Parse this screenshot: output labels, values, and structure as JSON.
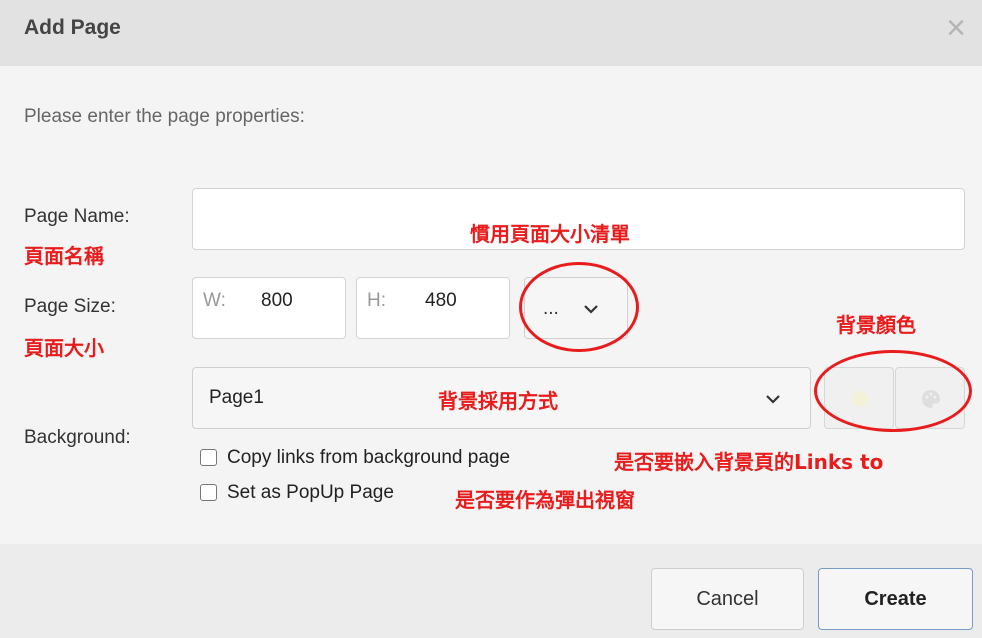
{
  "dialog": {
    "title": "Add Page",
    "close_glyph": "×",
    "intro": "Please enter the page properties:"
  },
  "page_name": {
    "label": "Page Name:",
    "value": "",
    "annotation": "頁面名稱",
    "hint": "慣用頁面大小清單"
  },
  "page_size": {
    "label": "Page Size:",
    "annotation": "頁面大小",
    "w_prefix": "W:",
    "w_value": "800",
    "h_prefix": "H:",
    "h_value": "480",
    "preset_label": "...",
    "color_note": "背景顏色"
  },
  "background": {
    "label": "Background:",
    "selected": "Page1",
    "annotation": "背景採用方式",
    "color_icons": [
      "color-swatch-icon",
      "palette-icon"
    ]
  },
  "options": {
    "copy_links": {
      "label": "Copy links from background page",
      "checked": false,
      "annotation": "是否要嵌入背景頁的Links to"
    },
    "popup": {
      "label": "Set as PopUp Page",
      "checked": false,
      "annotation": "是否要作為彈出視窗"
    }
  },
  "buttons": {
    "cancel": "Cancel",
    "create": "Create"
  },
  "colors": {
    "annotation_red": "#e81c1c",
    "header_bg": "#e2e2e2",
    "body_bg": "#f4f4f4"
  }
}
